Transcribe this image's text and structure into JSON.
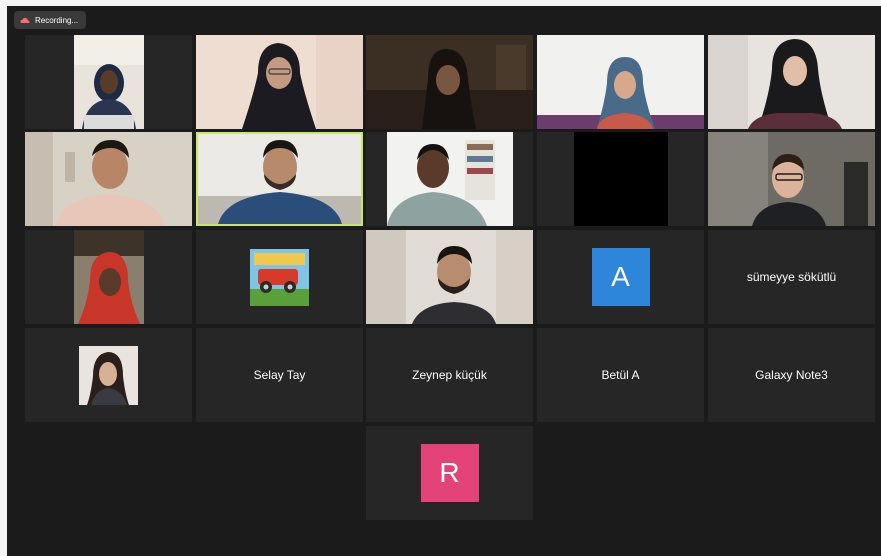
{
  "recording": {
    "label": "Recording..."
  },
  "colors": {
    "background": "#1b1b1b",
    "tile": "#262626",
    "active_border": "#c9e66a",
    "avatar_blue": "#2d86d9",
    "avatar_pink": "#e4437a",
    "recording_icon": "#ff6b6b"
  },
  "participants": [
    {
      "type": "video",
      "row": 1,
      "col": 1
    },
    {
      "type": "video",
      "row": 1,
      "col": 2
    },
    {
      "type": "video",
      "row": 1,
      "col": 3
    },
    {
      "type": "video",
      "row": 1,
      "col": 4
    },
    {
      "type": "video",
      "row": 1,
      "col": 5
    },
    {
      "type": "video",
      "row": 2,
      "col": 1
    },
    {
      "type": "video",
      "row": 2,
      "col": 2,
      "active_speaker": true
    },
    {
      "type": "video",
      "row": 2,
      "col": 3
    },
    {
      "type": "video-off",
      "row": 2,
      "col": 4
    },
    {
      "type": "video",
      "row": 2,
      "col": 5
    },
    {
      "type": "video",
      "row": 3,
      "col": 1
    },
    {
      "type": "profile-picture",
      "row": 3,
      "col": 2
    },
    {
      "type": "video",
      "row": 3,
      "col": 3
    },
    {
      "type": "avatar",
      "letter": "A",
      "row": 3,
      "col": 4
    },
    {
      "type": "name",
      "name": "sümeyye sökütlü",
      "row": 3,
      "col": 5
    },
    {
      "type": "profile-picture",
      "row": 4,
      "col": 1
    },
    {
      "type": "name",
      "name": "Selay Tay",
      "row": 4,
      "col": 2
    },
    {
      "type": "name",
      "name": "Zeynep küçük",
      "row": 4,
      "col": 3
    },
    {
      "type": "name",
      "name": "Betül A",
      "row": 4,
      "col": 4
    },
    {
      "type": "name",
      "name": "Galaxy Note3",
      "row": 4,
      "col": 5
    },
    {
      "type": "avatar",
      "letter": "R",
      "row": 5,
      "col": 3
    }
  ]
}
